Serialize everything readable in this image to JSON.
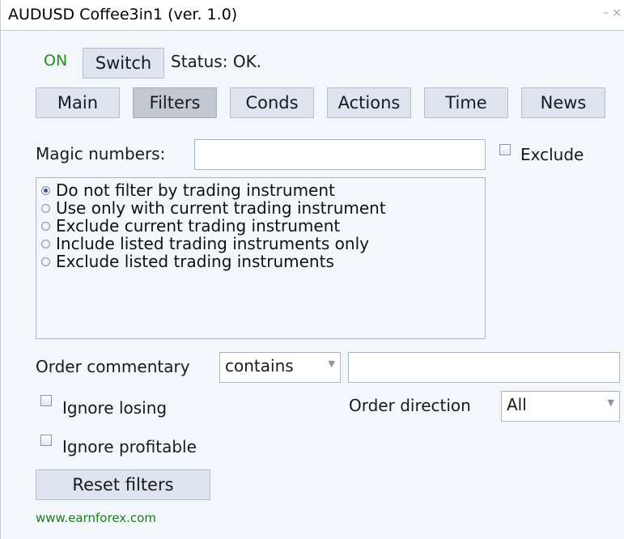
{
  "window": {
    "title": "AUDUSD Coffee3in1 (ver. 1.0)",
    "controls": "– ×"
  },
  "status": {
    "on_label": "ON",
    "switch_label": "Switch",
    "status_text": "Status: OK."
  },
  "tabs": [
    {
      "label": "Main"
    },
    {
      "label": "Filters",
      "active": true
    },
    {
      "label": "Conds"
    },
    {
      "label": "Actions"
    },
    {
      "label": "Time"
    },
    {
      "label": "News"
    }
  ],
  "filters": {
    "magic_label": "Magic numbers:",
    "magic_value": "",
    "exclude_label": "Exclude",
    "instrument_options": [
      {
        "label": "Do not filter by trading instrument",
        "checked": true
      },
      {
        "label": "Use only with current trading instrument",
        "checked": false
      },
      {
        "label": "Exclude current trading instrument",
        "checked": false
      },
      {
        "label": "Include listed trading instruments only",
        "checked": false
      },
      {
        "label": "Exclude listed trading instruments",
        "checked": false
      }
    ],
    "comment_label": "Order commentary",
    "comment_mode": "contains",
    "comment_value": "",
    "ignore_losing_label": "Ignore losing",
    "direction_label": "Order direction",
    "direction_value": "All",
    "ignore_profitable_label": "Ignore profitable",
    "reset_label": "Reset filters"
  },
  "footer": {
    "link": "www.earnforex.com"
  },
  "colors": {
    "on": "#1f8f1f",
    "link": "#1f7a1f",
    "panel_bg": "#f3f6fb",
    "button_bg": "#dde4ee",
    "active_tab_bg": "#c3c8d0"
  }
}
